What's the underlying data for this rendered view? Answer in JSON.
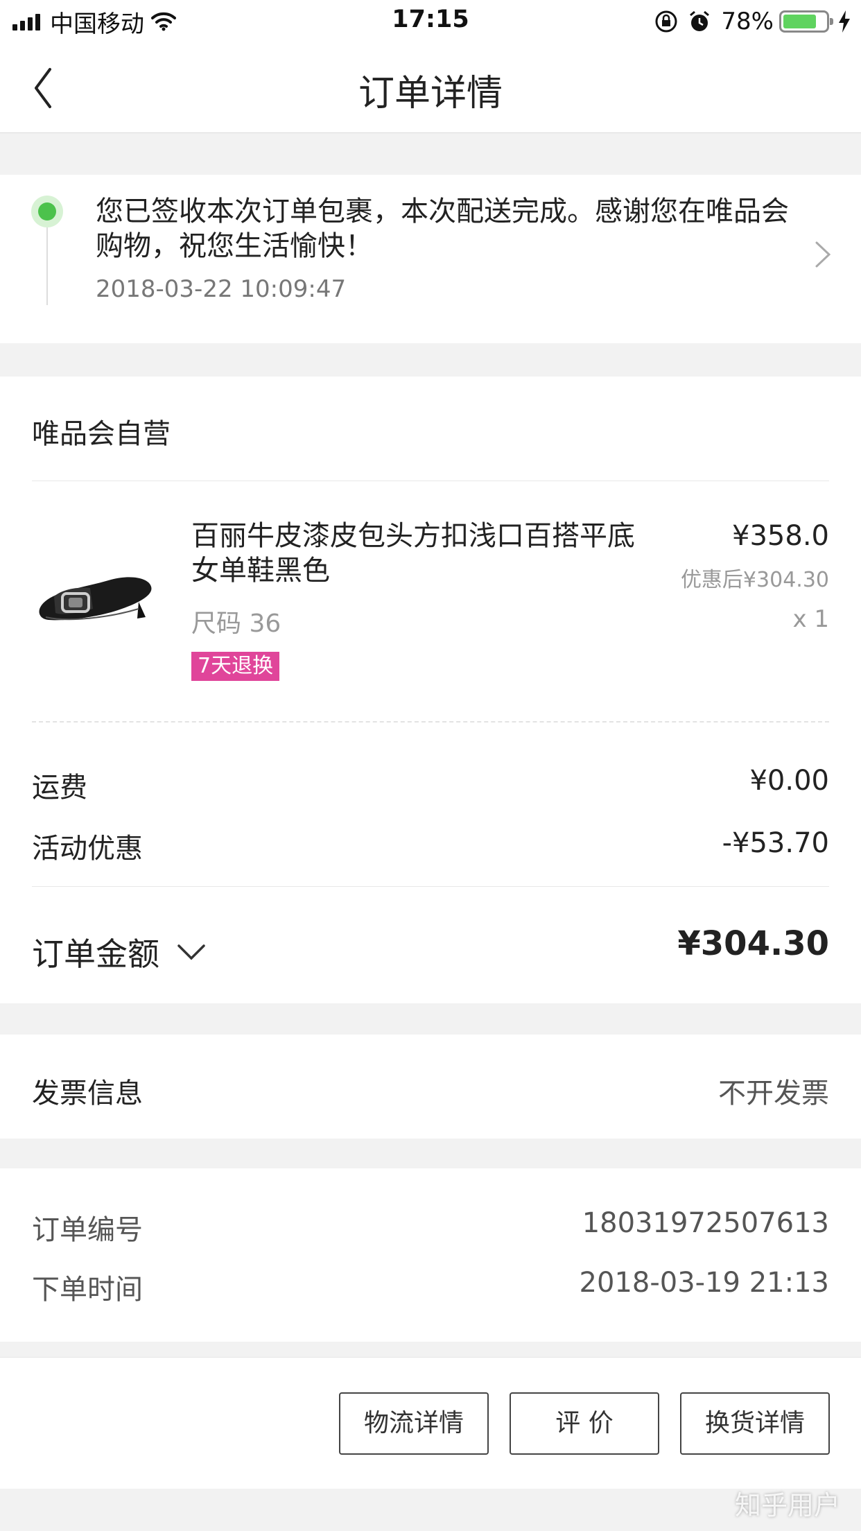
{
  "status_bar": {
    "carrier": "中国移动",
    "time": "17:15",
    "battery": "78%",
    "battery_level": 0.78
  },
  "nav": {
    "title": "订单详情"
  },
  "tracking": {
    "message": "您已签收本次订单包裹，本次配送完成。感谢您在唯品会购物，祝您生活愉快！",
    "time": "2018-03-22 10:09:47",
    "status_color": "#4cc24c"
  },
  "order": {
    "store": "唯品会自营",
    "product": {
      "name": "百丽牛皮漆皮包头方扣浅口百搭平底女单鞋黑色",
      "price": "¥358.0",
      "price_after": "优惠后¥304.30",
      "size": "尺码  36",
      "quantity": "x 1",
      "badge": "7天退换",
      "badge_color": "#e0459a"
    },
    "shipping_label": "运费",
    "shipping_value": "¥0.00",
    "discount_label": "活动优惠",
    "discount_value": "-¥53.70",
    "total_label": "订单金额",
    "total_value": "¥304.30"
  },
  "invoice": {
    "label": "发票信息",
    "value": "不开发票"
  },
  "info": {
    "order_no_label": "订单编号",
    "order_no": "18031972507613",
    "order_time_label": "下单时间",
    "order_time": "2018-03-19 21:13"
  },
  "actions": {
    "logistics": "物流详情",
    "review": "评 价",
    "exchange": "换货详情"
  },
  "watermark": "知乎用户",
  "icons": [
    "signal-icon",
    "wifi-icon",
    "orientation-lock-icon",
    "alarm-icon",
    "battery-icon",
    "charging-icon",
    "back-icon",
    "chevron-right-icon",
    "chevron-down-icon",
    "product-shoe-image"
  ]
}
